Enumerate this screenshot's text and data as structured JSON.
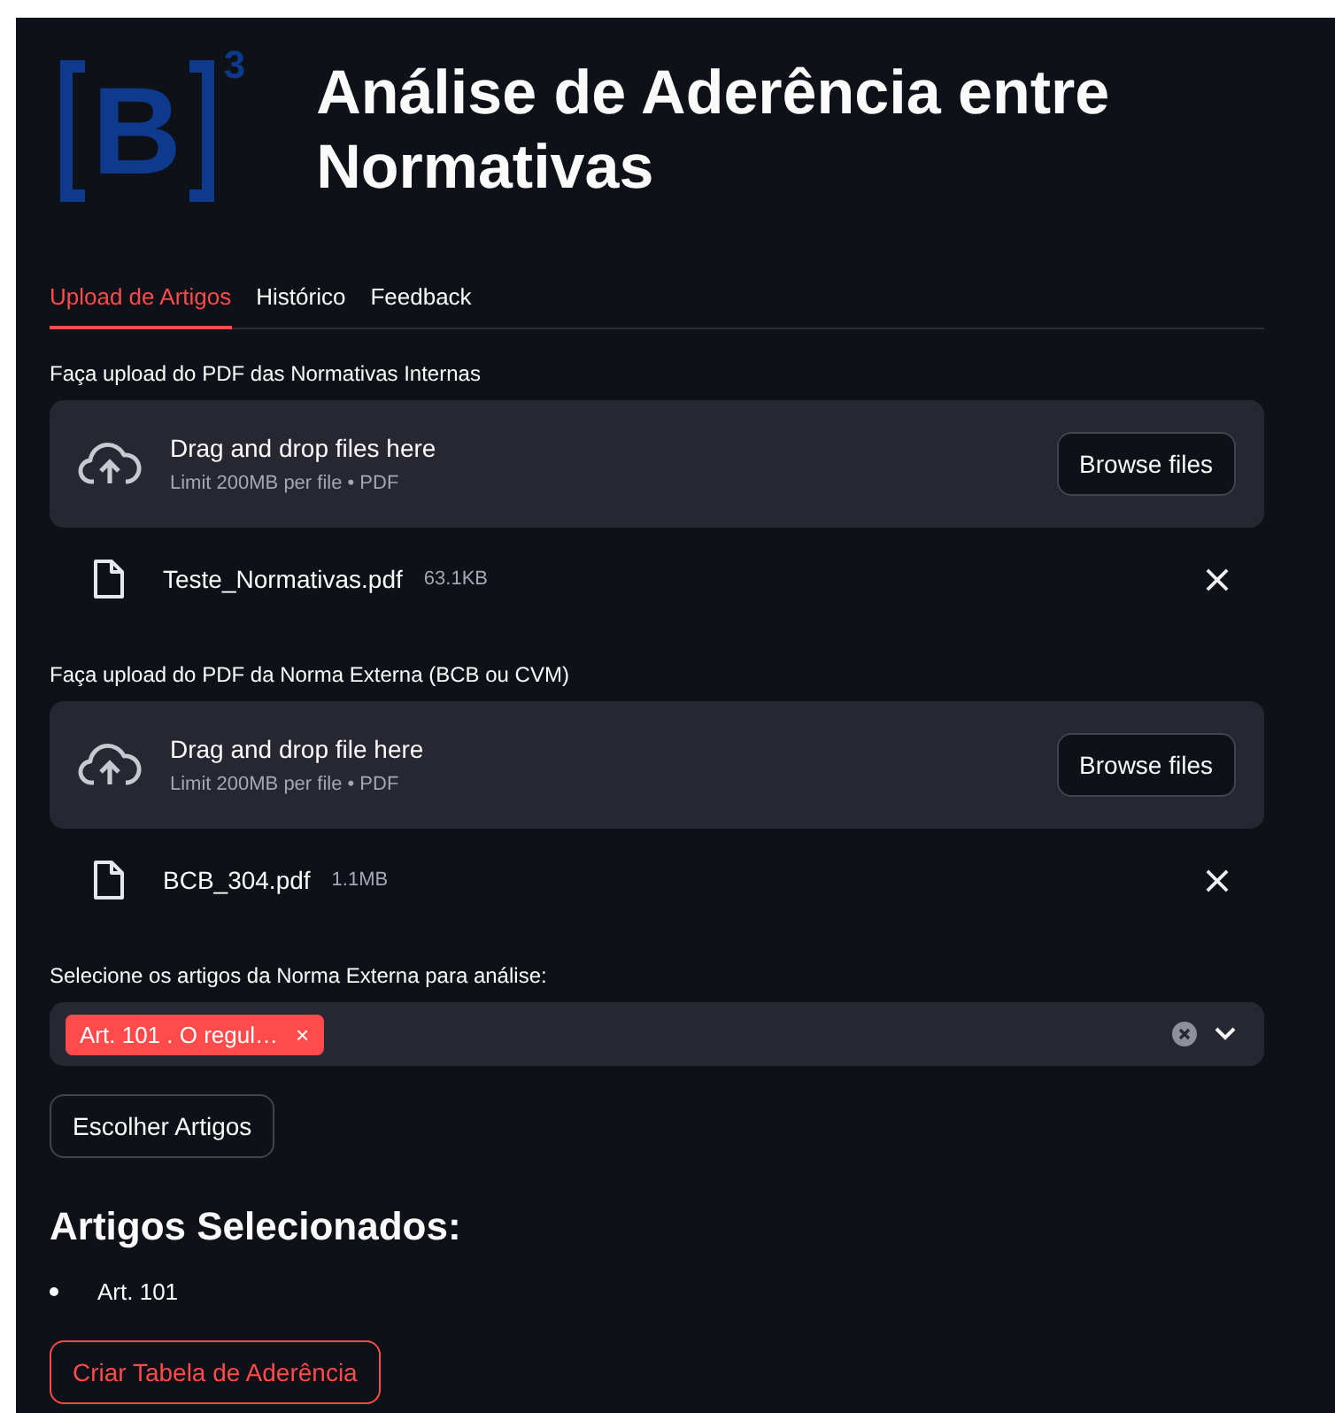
{
  "logo": {
    "letter": "B",
    "superscript": "3"
  },
  "title": "Análise de Aderência entre Normativas",
  "tabs": [
    {
      "label": "Upload de Artigos",
      "selected": true
    },
    {
      "label": "Histórico",
      "selected": false
    },
    {
      "label": "Feedback",
      "selected": false
    }
  ],
  "uploaders": [
    {
      "label": "Faça upload do PDF das Normativas Internas",
      "instruction": "Drag and drop files here",
      "limit": "Limit 200MB per file • PDF",
      "button": "Browse files",
      "files": [
        {
          "name": "Teste_Normativas.pdf",
          "size": "63.1KB"
        }
      ]
    },
    {
      "label": "Faça upload do PDF da Norma Externa (BCB ou CVM)",
      "instruction": "Drag and drop file here",
      "limit": "Limit 200MB per file • PDF",
      "button": "Browse files",
      "files": [
        {
          "name": "BCB_304.pdf",
          "size": "1.1MB"
        }
      ]
    }
  ],
  "multiselect": {
    "label": "Selecione os artigos da Norma Externa para análise:",
    "chips": [
      {
        "text": "Art. 101 . O regul…",
        "remove": "×"
      }
    ]
  },
  "choose_button": "Escolher Artigos",
  "selected_heading": "Artigos Selecionados:",
  "selected_items": [
    "Art. 101"
  ],
  "create_button": "Criar Tabela de Aderência"
}
